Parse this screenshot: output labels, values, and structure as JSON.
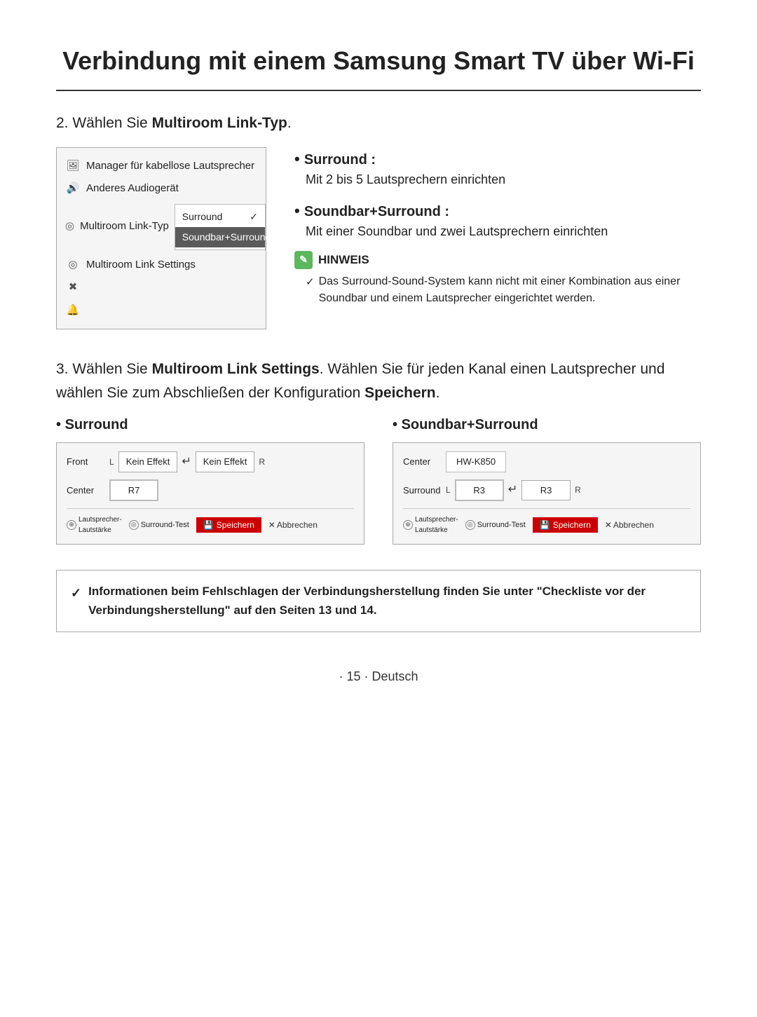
{
  "page": {
    "title": "Verbindung mit einem Samsung Smart TV über Wi-Fi",
    "step2": {
      "label": "2. Wählen Sie ",
      "label_bold": "Multiroom Link-Typ",
      "label_end": ".",
      "menu": {
        "items": [
          {
            "icon": "📷",
            "label": "Manager für kabellose Lautsprecher"
          },
          {
            "icon": "🔊",
            "label": "Anderes Audiogerät"
          },
          {
            "icon": "🔗",
            "label": "Multiroom Link-Typ",
            "has_dropdown": true
          },
          {
            "icon": "⚙",
            "label": "Multiroom Link Settings"
          },
          {
            "icon": "✖",
            "label": ""
          },
          {
            "icon": "🔔",
            "label": ""
          }
        ],
        "dropdown": {
          "option1": "Surround",
          "option2": "Soundbar+Surround"
        }
      },
      "bullets": [
        {
          "title": "Surround :",
          "desc": "Mit 2 bis 5 Lautsprechern einrichten"
        },
        {
          "title": "Soundbar+Surround :",
          "desc": "Mit einer Soundbar und zwei Lautsprechern einrichten"
        }
      ],
      "hinweis": {
        "title": "HINWEIS",
        "text": "Das Surround-Sound-System kann nicht mit einer Kombination aus einer Soundbar und einem Lautsprecher eingerichtet werden."
      }
    },
    "step3": {
      "label": "3. Wählen Sie ",
      "label_bold": "Multiroom Link Settings",
      "label_mid": ". Wählen Sie für jeden Kanal einen Lautsprecher und wählen Sie zum Abschließen der Konfiguration ",
      "label_speichern": "Speichern",
      "label_end": ".",
      "surround_title": "Surround",
      "soundbar_title": "Soundbar+Surround",
      "surround_panel": {
        "row1_label": "Front",
        "row1_L": "L",
        "row1_btn1": "Kein Effekt",
        "row1_arrow": "↵",
        "row1_btn2": "Kein Effekt",
        "row1_R": "R",
        "row2_label": "Center",
        "row2_btn": "R7",
        "footer": {
          "lautstaerke": "Lautsprecher-\nLautstärke",
          "surround_test": "Surround-Test",
          "speichern": "Speichern",
          "abbrechen": "Abbrechen"
        }
      },
      "soundbar_panel": {
        "row1_label": "Center",
        "row1_btn": "HW-K850",
        "row2_label": "Surround",
        "row2_L": "L",
        "row2_btn1": "R3",
        "row2_arrow": "↵",
        "row2_btn2": "R3",
        "row2_R": "R",
        "footer": {
          "lautstaerke": "Lautsprecher-\nLautstärke",
          "surround_test": "Surround-Test",
          "speichern": "Speichern",
          "abbrechen": "Abbrechen"
        }
      }
    },
    "bottom_note": "Informationen beim Fehlschlagen der Verbindungsherstellung finden Sie unter \"Checkliste vor der Verbindungsherstellung\" auf den Seiten 13 und 14.",
    "footer": "· 15 · Deutsch"
  }
}
